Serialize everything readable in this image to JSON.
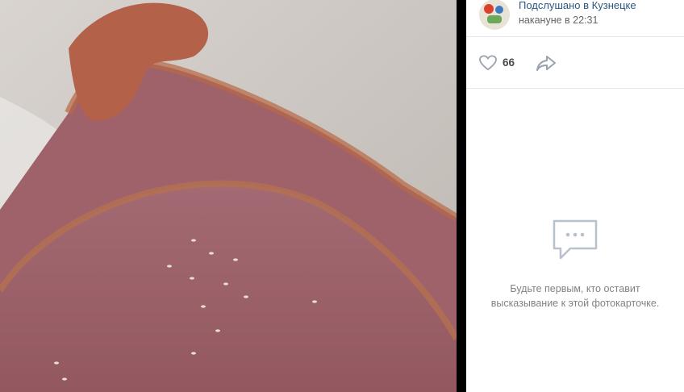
{
  "post": {
    "group_name": "Подслушано в Кузнецке",
    "time": "накануне в 22:31",
    "likes": "66"
  },
  "comments": {
    "empty_line1": "Будьте первым, кто оставит",
    "empty_line2": "высказывание к этой фотокарточке."
  },
  "colors": {
    "link": "#2a5885",
    "muted": "#828282",
    "icon": "#99a2ad"
  },
  "icons": [
    "heart-icon",
    "share-icon",
    "comment-bubble-icon"
  ]
}
